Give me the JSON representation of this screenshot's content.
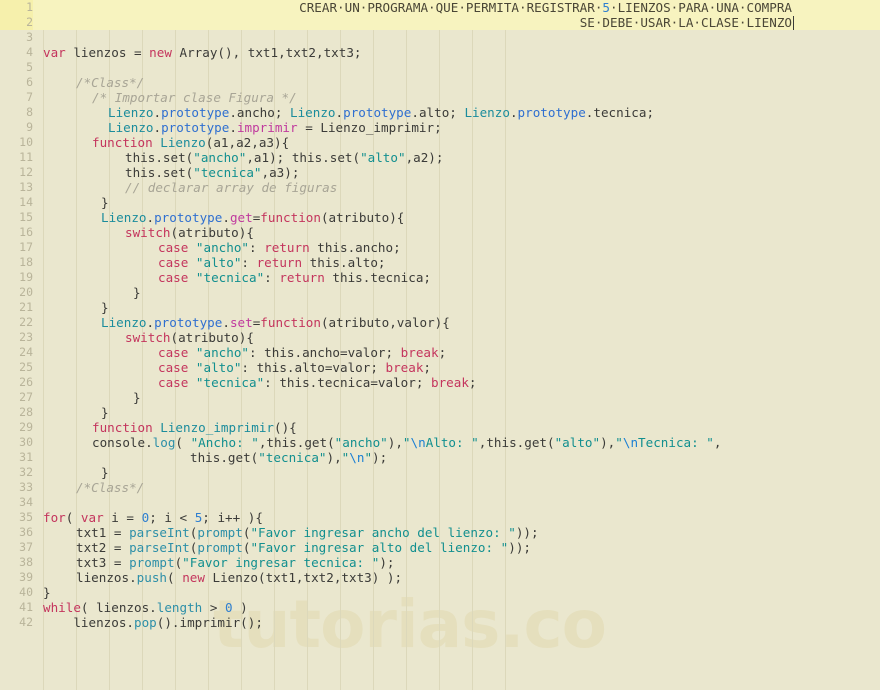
{
  "editor": {
    "theme_background": "#eae7ce",
    "highlight_background": "#f7f3bf",
    "gutter_highlight": "#f6f0ac",
    "language": "javascript",
    "total_lines": 42,
    "watermark": "tutorias.co"
  },
  "header_lines": [
    {
      "number": "1",
      "text": "CREAR·UN·PROGRAMA·QUE·PERMITA·REGISTRAR·5·LIENZOS·PARA·UNA·COMPRA"
    },
    {
      "number": "2",
      "text": "SE·DEBE·USAR·LA·CLASE·LIENZO"
    }
  ],
  "line_numbers": [
    "1",
    "2",
    "3",
    "4",
    "5",
    "6",
    "7",
    "8",
    "9",
    "10",
    "11",
    "12",
    "13",
    "14",
    "15",
    "16",
    "17",
    "18",
    "19",
    "20",
    "21",
    "22",
    "23",
    "24",
    "25",
    "26",
    "27",
    "28",
    "29",
    "30",
    "31",
    "32",
    "33",
    "34",
    "35",
    "36",
    "37",
    "38",
    "39",
    "40",
    "41",
    "42"
  ],
  "code": {
    "l3": "",
    "l4": "var lienzos = new Array(), txt1,txt2,txt3;",
    "l5": "",
    "l6": "    /*Class*/",
    "l7": "        /* Importar clase Figura */",
    "l8": "          Lienzo.prototype.ancho; Lienzo.prototype.alto; Lienzo.prototype.tecnica;",
    "l9": "          Lienzo.prototype.imprimir = Lienzo_imprimir;",
    "l10": "        function Lienzo(a1,a2,a3){",
    "l11": "            this.set(\"ancho\",a1); this.set(\"alto\",a2);",
    "l12": "            this.set(\"tecnica\",a3);",
    "l13": "            // declarar array de figuras",
    "l14": "        }",
    "l15": "        Lienzo.prototype.get=function(atributo){",
    "l16": "            switch(atributo){",
    "l17": "                case \"ancho\": return this.ancho;",
    "l18": "                case \"alto\": return this.alto;",
    "l19": "                case \"tecnica\": return this.tecnica;",
    "l20": "            }",
    "l21": "        }",
    "l22": "        Lienzo.prototype.set=function(atributo,valor){",
    "l23": "            switch(atributo){",
    "l24": "                case \"ancho\": this.ancho=valor; break;",
    "l25": "                case \"alto\": this.alto=valor; break;",
    "l26": "                case \"tecnica\": this.tecnica=valor; break;",
    "l27": "            }",
    "l28": "        }",
    "l29": "        function Lienzo_imprimir(){",
    "l30": "        console.log( \"Ancho: \",this.get(\"ancho\"),\"\\nAlto: \",this.get(\"alto\"),\"\\nTecnica: \",",
    "l31": "                    this.get(\"tecnica\"),\"\\n\");",
    "l32": "        }",
    "l33": "    /*Class*/",
    "l34": "",
    "l35": "for( var i = 0; i < 5; i++ ){",
    "l36": "    txt1 = parseInt(prompt(\"Favor ingresar ancho del lienzo: \"));",
    "l37": "    txt2 = parseInt(prompt(\"Favor ingresar alto del lienzo: \"));",
    "l38": "    txt3 = prompt(\"Favor ingresar tecnica: \");",
    "l39": "    lienzos.push( new Lienzo(txt1,txt2,txt3) );",
    "l40": "}",
    "l41": "while( lienzos.length > 0 )",
    "l42": "    lienzos.pop().imprimir();"
  },
  "tokens": {
    "hdr1_a": "CREAR·UN·PROGRAMA·QUE·PERMITA·REGISTRAR·",
    "hdr1_num": "5",
    "hdr1_b": "·LIENZOS·PARA·UNA·COMPRA",
    "hdr2": "SE·DEBE·USAR·LA·CLASE·LIENZO",
    "t4_var": "var",
    "t4_a": " lienzos ",
    "t4_eq": "=",
    "t4_new": " new",
    "t4_b": " Array(), txt1,txt2,txt3;",
    "t6": "/*Class*/",
    "t7": "/* Importar clase Figura */",
    "t8_c1": "Lienzo",
    "t8_d1": ".",
    "t8_p1": "prototype",
    "t8_r1": ".ancho; ",
    "t8_c2": "Lienzo",
    "t8_p2": "prototype",
    "t8_r2": ".alto; ",
    "t8_c3": "Lienzo",
    "t8_p3": "prototype",
    "t8_r3": ".tecnica;",
    "t9_c": "Lienzo",
    "t9_p": "prototype",
    "t9_m": "imprimir",
    "t9_r": " = Lienzo_imprimir;",
    "t10_kw": "function",
    "t10_name": " Lienzo",
    "t10_r": "(a1,a2,a3){",
    "t11_a": "this.set(",
    "t11_s1": "\"ancho\"",
    "t11_b": ",a1); this.set(",
    "t11_s2": "\"alto\"",
    "t11_c": ",a2);",
    "t12_a": "this.set(",
    "t12_s": "\"tecnica\"",
    "t12_b": ",a3);",
    "t13": "// declarar array de figuras",
    "t14": "}",
    "t15_c": "Lienzo",
    "t15_p": "prototype",
    "t15_g": "get",
    "t15_eq": "=",
    "t15_kw": "function",
    "t15_r": "(atributo){",
    "t16_kw": "switch",
    "t16_r": "(atributo){",
    "t17_case": "case",
    "t17_s": " \"ancho\"",
    "t17_c": ": ",
    "t17_ret": "return",
    "t17_r": " this.ancho;",
    "t18_case": "case",
    "t18_s": " \"alto\"",
    "t18_c": ": ",
    "t18_ret": "return",
    "t18_r": " this.alto;",
    "t19_case": "case",
    "t19_s": " \"tecnica\"",
    "t19_c": ": ",
    "t19_ret": "return",
    "t19_r": " this.tecnica;",
    "t20": "}",
    "t21": "}",
    "t22_c": "Lienzo",
    "t22_p": "prototype",
    "t22_s": "set",
    "t22_eq": "=",
    "t22_kw": "function",
    "t22_r": "(atributo,valor){",
    "t23_kw": "switch",
    "t23_r": "(atributo){",
    "t24_case": "case",
    "t24_s": " \"ancho\"",
    "t24_r": ": this.ancho=valor; ",
    "t24_brk": "break",
    "t24_end": ";",
    "t25_case": "case",
    "t25_s": " \"alto\"",
    "t25_r": ": this.alto=valor; ",
    "t25_brk": "break",
    "t25_end": ";",
    "t26_case": "case",
    "t26_s": " \"tecnica\"",
    "t26_r": ": this.tecnica=valor; ",
    "t26_brk": "break",
    "t26_end": ";",
    "t27": "}",
    "t28": "}",
    "t29_kw": "function",
    "t29_name": " Lienzo_imprimir",
    "t29_r": "(){",
    "t30_a": "console.",
    "t30_log": "log",
    "t30_b": "( ",
    "t30_s1": "\"Ancho: \"",
    "t30_c1": ",this.get(",
    "t30_s2": "\"ancho\"",
    "t30_c2": "),",
    "t30_q1": "\"",
    "t30_e1": "\\n",
    "t30_s3": "Alto: \"",
    "t30_c3": ",this.get(",
    "t30_s4": "\"alto\"",
    "t30_c4": "),",
    "t30_q2": "\"",
    "t30_e2": "\\n",
    "t30_s5": "Tecnica: \"",
    "t30_c5": ",",
    "t31_a": "this.get(",
    "t31_s": "\"tecnica\"",
    "t31_b": "),",
    "t31_q": "\"",
    "t31_e": "\\n",
    "t31_q2": "\"",
    "t31_c": ");",
    "t32": "}",
    "t33": "/*Class*/",
    "t35_for": "for",
    "t35_a": "( ",
    "t35_var": "var",
    "t35_b": " i = ",
    "t35_n0": "0",
    "t35_c": "; i < ",
    "t35_n5": "5",
    "t35_d": "; i++ ){",
    "t36_a": "txt1 = ",
    "t36_f1": "parseInt",
    "t36_b": "(",
    "t36_f2": "prompt",
    "t36_c": "(",
    "t36_s": "\"Favor ingresar ancho del lienzo: \"",
    "t36_d": "));",
    "t37_a": "txt2 = ",
    "t37_f1": "parseInt",
    "t37_b": "(",
    "t37_f2": "prompt",
    "t37_c": "(",
    "t37_s": "\"Favor ingresar alto del lienzo: \"",
    "t37_d": "));",
    "t38_a": "txt3 = ",
    "t38_f": "prompt",
    "t38_b": "(",
    "t38_s": "\"Favor ingresar tecnica: \"",
    "t38_c": ");",
    "t39_a": "lienzos.",
    "t39_push": "push",
    "t39_b": "( ",
    "t39_new": "new",
    "t39_c": " Lienzo(txt1,txt2,txt3) );",
    "t40": "}",
    "t41_kw": "while",
    "t41_a": "( lienzos.",
    "t41_len": "length",
    "t41_b": " > ",
    "t41_n": "0",
    "t41_c": " )",
    "t42_a": "    lienzos.",
    "t42_pop": "pop",
    "t42_b": "().imprimir",
    "t42_c": "();"
  }
}
